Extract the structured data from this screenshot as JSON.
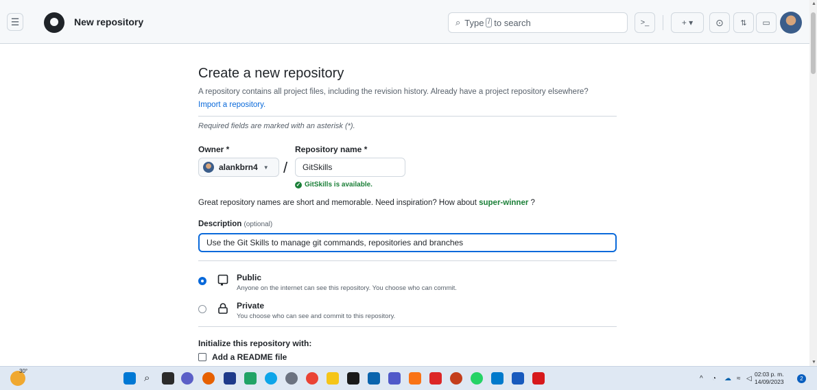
{
  "header": {
    "title": "New repository",
    "search_prefix": "Type",
    "search_key": "/",
    "search_suffix": "to search",
    "cmd_label": ">_",
    "plus_label": "+ ▾"
  },
  "page": {
    "heading": "Create a new repository",
    "lead": "A repository contains all project files, including the revision history. Already have a project repository elsewhere?",
    "import_link": "Import a repository.",
    "required_note": "Required fields are marked with an asterisk (*)."
  },
  "form": {
    "owner_label": "Owner *",
    "owner_value": "alankbrn4",
    "repo_label": "Repository name *",
    "repo_value": "GitSkills",
    "availability": "GitSkills is available.",
    "suggestion_prefix": "Great repository names are short and memorable. Need inspiration? How about",
    "suggestion": "super-winner",
    "suggestion_suffix": "?",
    "description_label": "Description",
    "description_optional": "(optional)",
    "description_value": "Use the Git Skills to manage git commands, repositories and branches"
  },
  "visibility": {
    "public_title": "Public",
    "public_sub": "Anyone on the internet can see this repository. You choose who can commit.",
    "private_title": "Private",
    "private_sub": "You choose who can see and commit to this repository.",
    "selected": "public"
  },
  "init": {
    "heading": "Initialize this repository with:",
    "readme_label": "Add a README file"
  },
  "taskbar": {
    "weather_temp": "30°",
    "clock_time": "02:03 p. m.",
    "clock_date": "14/09/2023",
    "notifications": "2"
  }
}
